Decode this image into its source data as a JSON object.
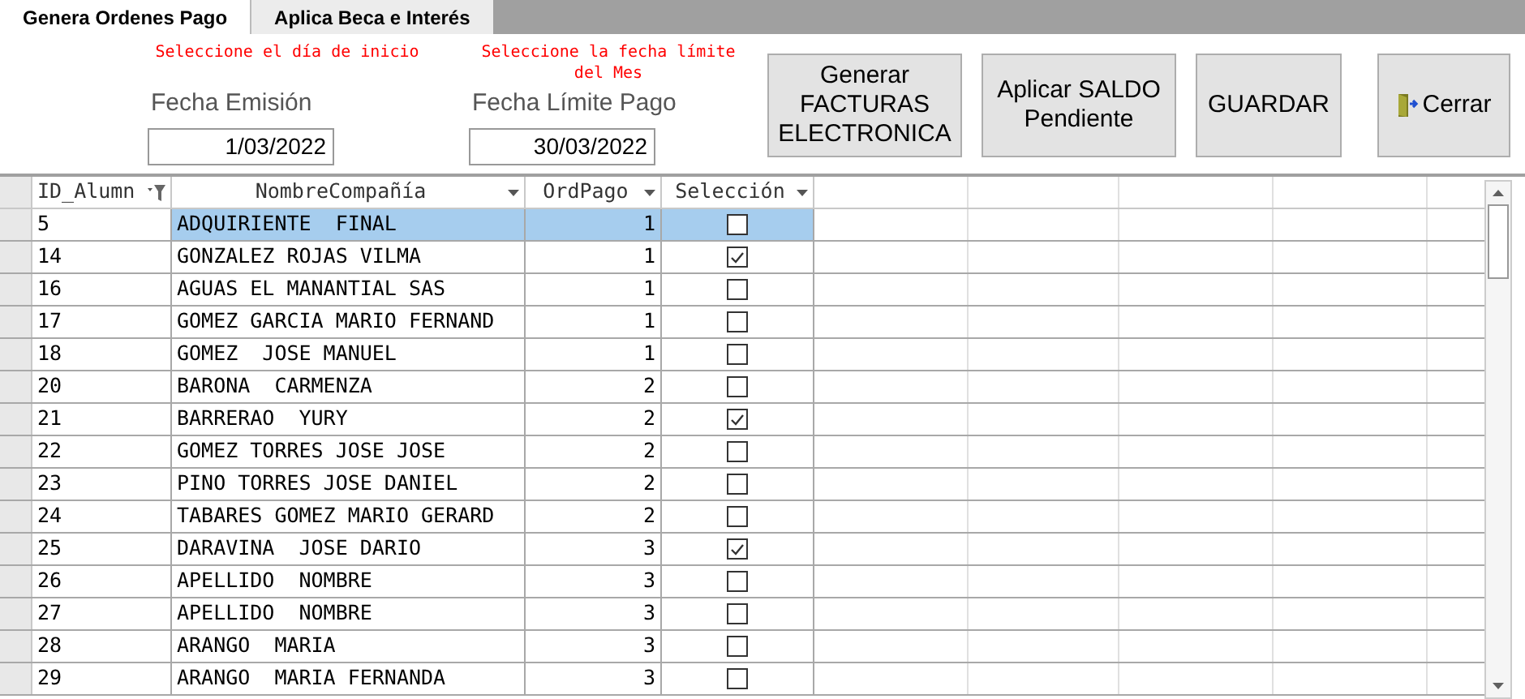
{
  "tabs": [
    {
      "label": "Genera Ordenes Pago",
      "selected": true
    },
    {
      "label": "Aplica Beca e Interés",
      "selected": false
    }
  ],
  "date_fields": [
    {
      "hint": "Seleccione el día de inicio",
      "label": "Fecha Emisión",
      "value": "1/03/2022"
    },
    {
      "hint": "Seleccione la fecha límite del Mes",
      "label": "Fecha Límite Pago",
      "value": "30/03/2022"
    }
  ],
  "buttons": [
    {
      "label": "Generar FACTURAS ELECTRONICA",
      "kind": "plain"
    },
    {
      "label": "Aplicar SALDO Pendiente",
      "kind": "plain"
    },
    {
      "label": "GUARDAR",
      "kind": "plain"
    },
    {
      "label": "Cerrar",
      "kind": "exit"
    }
  ],
  "table": {
    "columns": [
      {
        "label": "ID_Alumn",
        "filtered": true
      },
      {
        "label": "NombreCompañía",
        "filtered": false
      },
      {
        "label": "OrdPago",
        "filtered": false
      },
      {
        "label": "Selección",
        "filtered": false
      }
    ],
    "rows": [
      {
        "id": "5",
        "name": "ADQUIRIENTE  FINAL",
        "ord": "1",
        "checked": false,
        "selected": true
      },
      {
        "id": "14",
        "name": "GONZALEZ ROJAS VILMA",
        "ord": "1",
        "checked": true,
        "selected": false
      },
      {
        "id": "16",
        "name": "AGUAS EL MANANTIAL SAS",
        "ord": "1",
        "checked": false,
        "selected": false
      },
      {
        "id": "17",
        "name": "GOMEZ GARCIA MARIO FERNAND",
        "ord": "1",
        "checked": false,
        "selected": false
      },
      {
        "id": "18",
        "name": "GOMEZ  JOSE MANUEL",
        "ord": "1",
        "checked": false,
        "selected": false
      },
      {
        "id": "20",
        "name": "BARONA  CARMENZA",
        "ord": "2",
        "checked": false,
        "selected": false
      },
      {
        "id": "21",
        "name": "BARRERAO  YURY",
        "ord": "2",
        "checked": true,
        "selected": false
      },
      {
        "id": "22",
        "name": "GOMEZ TORRES JOSE JOSE",
        "ord": "2",
        "checked": false,
        "selected": false
      },
      {
        "id": "23",
        "name": "PINO TORRES JOSE DANIEL",
        "ord": "2",
        "checked": false,
        "selected": false
      },
      {
        "id": "24",
        "name": "TABARES GOMEZ MARIO GERARD",
        "ord": "2",
        "checked": false,
        "selected": false
      },
      {
        "id": "25",
        "name": "DARAVINA  JOSE DARIO",
        "ord": "3",
        "checked": true,
        "selected": false
      },
      {
        "id": "26",
        "name": "APELLIDO  NOMBRE",
        "ord": "3",
        "checked": false,
        "selected": false
      },
      {
        "id": "27",
        "name": "APELLIDO  NOMBRE",
        "ord": "3",
        "checked": false,
        "selected": false
      },
      {
        "id": "28",
        "name": "ARANGO  MARIA",
        "ord": "3",
        "checked": false,
        "selected": false
      },
      {
        "id": "29",
        "name": "ARANGO  MARIA FERNANDA",
        "ord": "3",
        "checked": false,
        "selected": false
      }
    ]
  }
}
